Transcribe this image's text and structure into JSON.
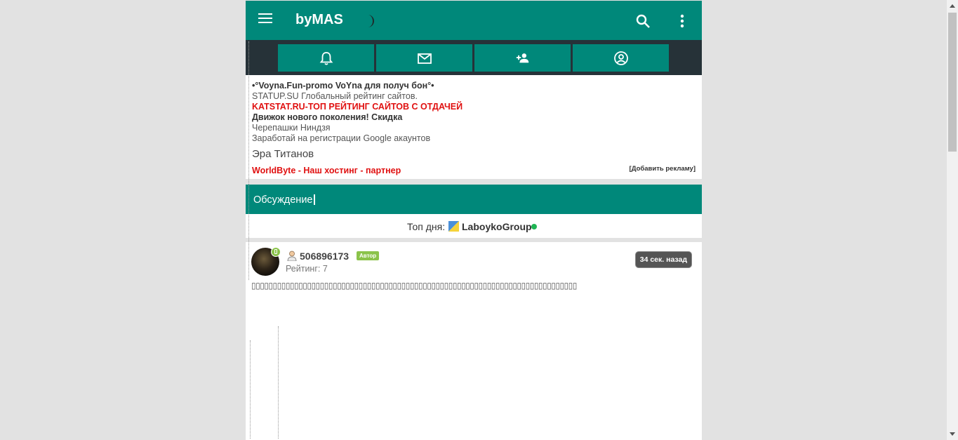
{
  "header": {
    "logo": "byMAS",
    "icons": [
      "menu-icon",
      "moon-icon",
      "search-icon",
      "more-vert-icon"
    ]
  },
  "nav": {
    "icons": [
      "bell-icon",
      "mail-icon",
      "add-friend-icon",
      "account-icon"
    ]
  },
  "ads": {
    "items": [
      "•°Voyna.Fun-promo VoYna для получ бон°•",
      "STATUP.SU Глобальный рейтинг сайтов.",
      "KATSTAT.RU-ТОП РЕЙТИНГ САЙТОВ С ОТДАЧЕЙ",
      "Движок нового поколения! Скидка",
      "Черепашки Ниндзя",
      "Заработай на регистрации Google акаунтов",
      "Эра Титанов",
      "WorldByte - Наш хостинг - партнер"
    ],
    "add_link": "[Добавить рекламу]"
  },
  "discussion": {
    "title": "Обсуждение",
    "top_day_label": "Топ дня:",
    "top_day_name": "LaboykoGroup"
  },
  "post": {
    "username": "506896173",
    "badge": "Автор",
    "rating": "Рейтинг: 7",
    "time": "34 сек. назад",
    "text": "▯▯▯▯▯▯▯▯▯▯▯▯▯▯▯▯▯▯▯▯▯▯▯▯▯▯▯▯▯▯▯▯▯▯▯▯▯▯▯▯▯▯▯▯▯▯▯▯▯▯▯▯▯▯▯▯▯▯▯▯▯▯▯▯▯▯▯▯▯▯▯▯▯▯▯▯"
  },
  "colors": {
    "primary": "#00887a",
    "navbar": "#263238",
    "ad_red": "#e01010",
    "author_badge": "#8bc34a",
    "online": "#1fb554"
  }
}
